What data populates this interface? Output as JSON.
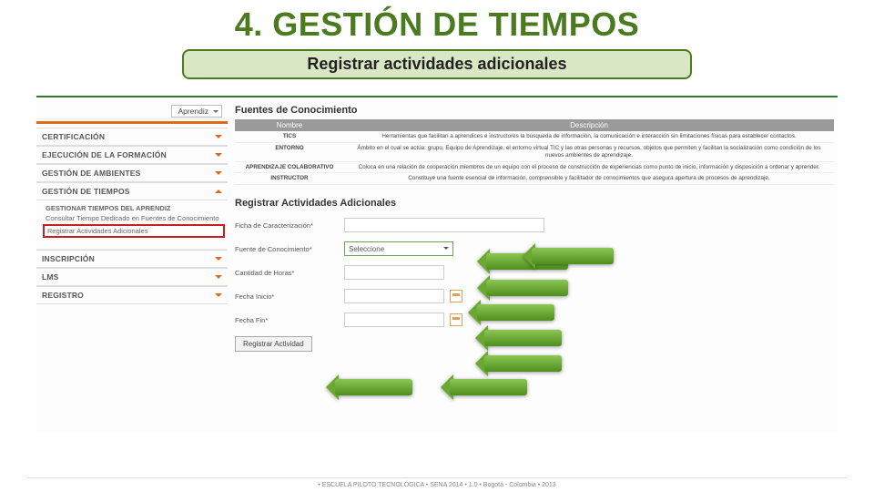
{
  "slide": {
    "title": "4. GESTIÓN DE TIEMPOS",
    "subtitle": "Registrar actividades adicionales"
  },
  "sidebar": {
    "roleSelect": "Aprendiz",
    "sections": [
      {
        "label": "CERTIFICACIÓN"
      },
      {
        "label": "EJECUCIÓN DE LA FORMACIÓN"
      },
      {
        "label": "GESTIÓN DE AMBIENTES"
      },
      {
        "label": "GESTIÓN DE TIEMPOS",
        "open": true,
        "children": [
          {
            "label": "GESTIONAR TIEMPOS DEL APRENDIZ",
            "bold": true
          },
          {
            "label": "Consultar Tiempo Dedicado en Fuentes de Conocimiento"
          },
          {
            "label": "Registrar Actividades Adicionales",
            "highlight": true
          }
        ]
      },
      {
        "label": "INSCRIPCIÓN"
      },
      {
        "label": "LMS"
      },
      {
        "label": "REGISTRO"
      }
    ]
  },
  "main": {
    "header1": "Fuentes de Conocimiento",
    "tableHead": {
      "name": "Nombre",
      "desc": "Descripción"
    },
    "rows": [
      {
        "name": "TICS",
        "desc": "Herramientas que facilitan a aprendices e instructores la búsqueda de información, la comunicación e interacción sin limitaciones físicas para establecer contactos."
      },
      {
        "name": "ENTORNO",
        "desc": "Ámbito en el cual se actúa: grupo, Equipo de Aprendizaje, el entorno virtual TIC y las otras personas y recursos, objetos que permiten y facilitan la socialización como condición de los nuevos ambientes de aprendizaje."
      },
      {
        "name": "APRENDIZAJE COLABORATIVO",
        "desc": "Coloca en una relación de cooperación miembros de un equipo con el proceso de construcción de experiencias como punto de inicio, información y disposición a ordenar y aprender."
      },
      {
        "name": "INSTRUCTOR",
        "desc": "Constituye una fuente esencial de información, comprensible y facilitador de conocimientos que asegura apertura de procesos de aprendizaje."
      }
    ],
    "header2": "Registrar Actividades Adicionales",
    "form": {
      "ficha": {
        "label": "Ficha de Caracterización*",
        "value": ""
      },
      "fuente": {
        "label": "Fuente de Conocimiento*",
        "placeholder": "Seleccione"
      },
      "horas": {
        "label": "Cantidad de Horas*",
        "value": ""
      },
      "inicio": {
        "label": "Fecha Inicio*",
        "value": ""
      },
      "fin": {
        "label": "Fecha Fin*",
        "value": ""
      },
      "submit": "Registrar Actividad"
    }
  },
  "footer": "• ESCUELA PILOTO TECNOLÓGICA • SENA 2014 • 1.0 • Bogotá - Colombia • 2013"
}
